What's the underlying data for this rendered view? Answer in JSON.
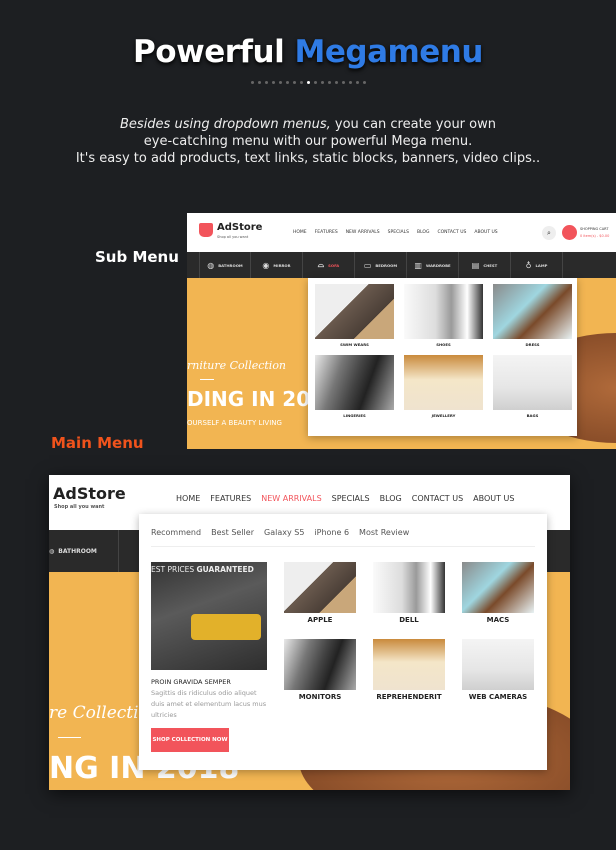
{
  "header": {
    "title_white": "Powerful",
    "title_blue": "Megamenu",
    "dots_total": 17,
    "dots_active_index": 8,
    "desc_italic": "Besides using dropdown menus,",
    "desc_rest": " you can create your own",
    "desc_line2": "eye-catching menu with our powerful Mega menu.",
    "desc_line3": "It's easy to add products, text links, static blocks, banners, video clips.."
  },
  "labels": {
    "sub_menu": "Sub Menu",
    "main_menu": "Main Menu"
  },
  "colors": {
    "background": "#1d1f22",
    "accent_blue": "#2f7be5",
    "main_menu_label": "#f0531c",
    "brand_red": "#f2545b",
    "banner_yellow": "#f2b552"
  },
  "store": {
    "logo": "AdStore",
    "tagline": "Shop all you want",
    "nav": [
      "HOME",
      "FEATURES",
      "NEW ARRIVALS",
      "SPECIALS",
      "BLOG",
      "CONTACT US",
      "ABOUT US"
    ],
    "cart_label": "SHOPPING CART",
    "cart_value": "0 item(s) - $0.00"
  },
  "sub_menu_shot": {
    "categories": [
      {
        "label": "BATHROOM",
        "icon": "bathtub-icon"
      },
      {
        "label": "MIRROR",
        "icon": "mirror-icon"
      },
      {
        "label": "SOFA",
        "icon": "sofa-icon",
        "active": true
      },
      {
        "label": "BEDROOM",
        "icon": "bed-icon"
      },
      {
        "label": "WARDROBE",
        "icon": "wardrobe-icon"
      },
      {
        "label": "CHEST",
        "icon": "chest-icon"
      },
      {
        "label": "LAMP",
        "icon": "lamp-icon"
      }
    ],
    "tiles": [
      "SWIM WEARS",
      "SHOES",
      "DRESS",
      "LINGERIES",
      "JEWELLERY",
      "BAGS"
    ],
    "banner": {
      "script": "rniture Collection",
      "headline": "DING IN 20",
      "sub": "OURSELF A BEAUTY LIVING"
    }
  },
  "main_menu_shot": {
    "active_nav": "NEW ARRIVALS",
    "category_visible": "BATHROOM",
    "tabs": [
      "Recommend",
      "Best Seller",
      "Galaxy S5",
      "iPhone 6",
      "Most Review"
    ],
    "promo": {
      "banner_text_light": "EST PRICES ",
      "banner_text_bold": "GUARANTEED",
      "title": "PROIN GRAVIDA SEMPER",
      "text": "Sagittis dis ridiculus odio aliquet duis amet et elementum lacus mus ultricies",
      "button": "SHOP COLLECTION NOW"
    },
    "tiles": [
      "APPLE",
      "DELL",
      "MACS",
      "MONITORS",
      "REPREHENDERIT",
      "WEB CAMERAS"
    ],
    "banner": {
      "script": "re Collectio",
      "headline": "NG IN 2018"
    }
  }
}
